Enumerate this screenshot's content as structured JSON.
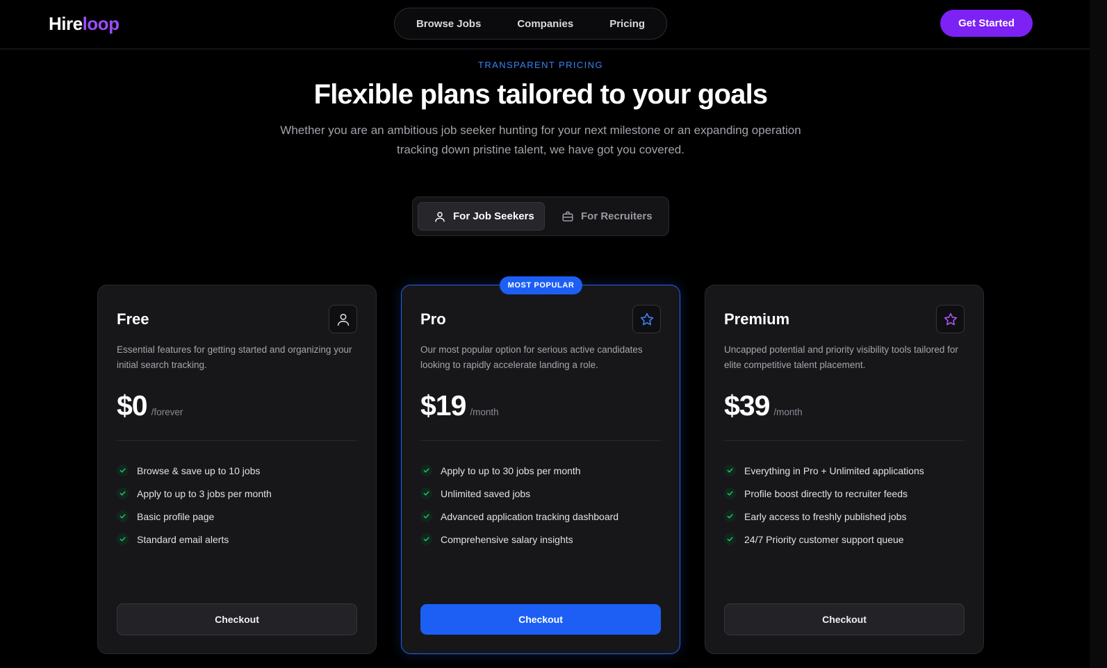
{
  "header": {
    "logo_part1": "Hire",
    "logo_part2": "loop",
    "nav": [
      "Browse Jobs",
      "Companies",
      "Pricing"
    ],
    "cta": "Get Started"
  },
  "hero": {
    "eyebrow": "TRANSPARENT PRICING",
    "title": "Flexible plans tailored to your goals",
    "subtitle": "Whether you are an ambitious job seeker hunting for your next milestone or an expanding operation tracking down pristine talent, we have got you covered."
  },
  "toggle": {
    "seekers": "For Job Seekers",
    "recruiters": "For Recruiters"
  },
  "plans": [
    {
      "name": "Free",
      "icon": "user-icon",
      "description": "Essential features for getting started and organizing your initial search tracking.",
      "price": "$0",
      "period": "/forever",
      "features": [
        "Browse & save up to 10 jobs",
        "Apply to up to 3 jobs per month",
        "Basic profile page",
        "Standard email alerts"
      ],
      "button": "Checkout"
    },
    {
      "name": "Pro",
      "badge": "MOST POPULAR",
      "icon": "star-icon",
      "description": "Our most popular option for serious active candidates looking to rapidly accelerate landing a role.",
      "price": "$19",
      "period": "/month",
      "features": [
        "Apply to up to 30 jobs per month",
        "Unlimited saved jobs",
        "Advanced application tracking dashboard",
        "Comprehensive salary insights"
      ],
      "button": "Checkout"
    },
    {
      "name": "Premium",
      "icon": "star-icon",
      "description": "Uncapped potential and priority visibility tools tailored for elite competitive talent placement.",
      "price": "$39",
      "period": "/month",
      "features": [
        "Everything in Pro + Unlimited applications",
        "Profile boost directly to recruiter feeds",
        "Early access to freshly published jobs",
        "24/7 Priority customer support queue"
      ],
      "button": "Checkout"
    }
  ],
  "colors": {
    "accent_purple": "#7c22f5",
    "accent_blue": "#1d5ff5",
    "check_green": "#22c55e",
    "star_blue": "#3b82f6",
    "star_purple": "#a855f7"
  }
}
